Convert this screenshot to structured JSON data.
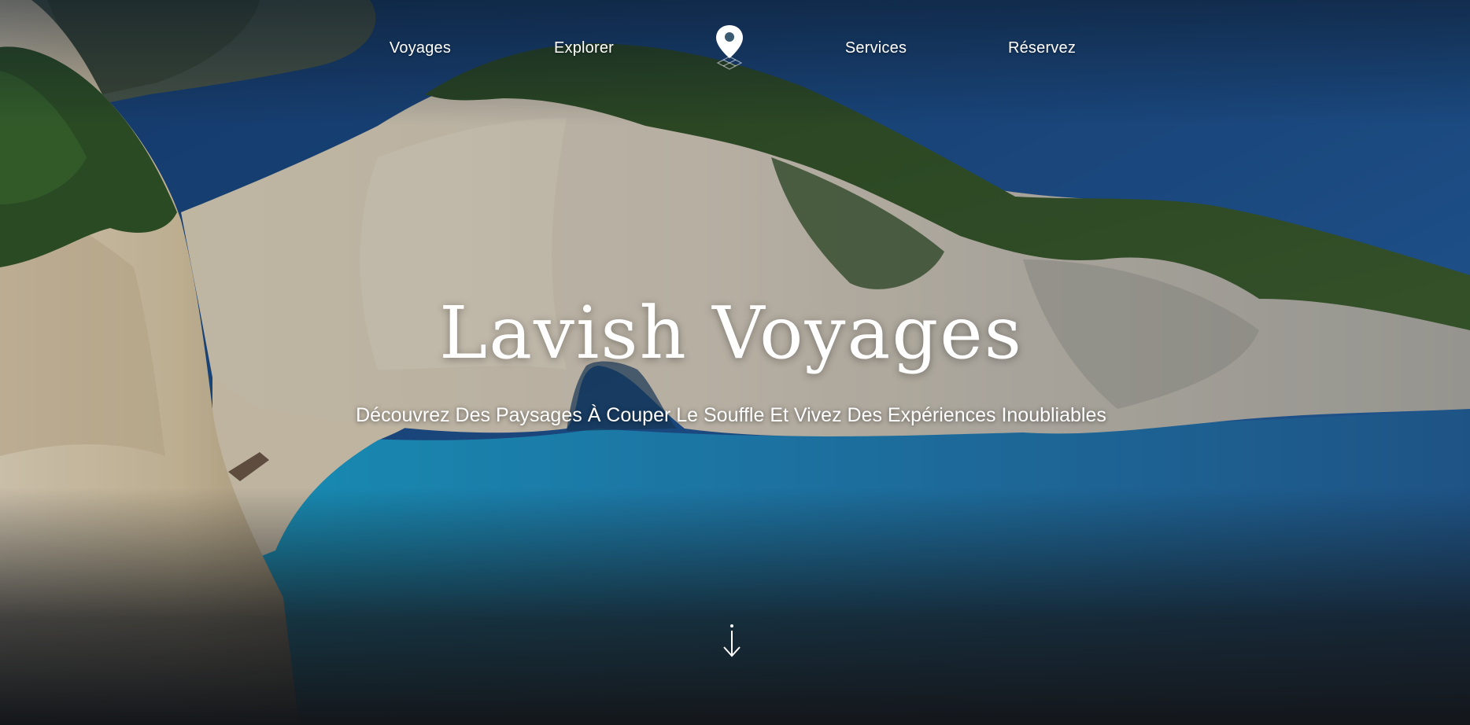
{
  "nav": {
    "items": [
      {
        "label": "Voyages"
      },
      {
        "label": "Explorer"
      },
      {
        "label": "Services"
      },
      {
        "label": "Réservez"
      }
    ],
    "logo_icon": "map-pin-icon"
  },
  "hero": {
    "title": "Lavish Voyages",
    "subtitle": "Découvrez Des Paysages À Couper Le Souffle Et Vivez Des Expériences Inoubliables",
    "scroll_icon": "arrow-down-icon",
    "background_subject": "cliff-cove-beach-photo"
  },
  "colors": {
    "text": "#ffffff",
    "sea_deep": "#1a4f86",
    "lagoon": "#1f86b8",
    "vegetation": "#2f4d23",
    "cliff": "#cfc6b4",
    "footer_dark": "#16181a"
  }
}
